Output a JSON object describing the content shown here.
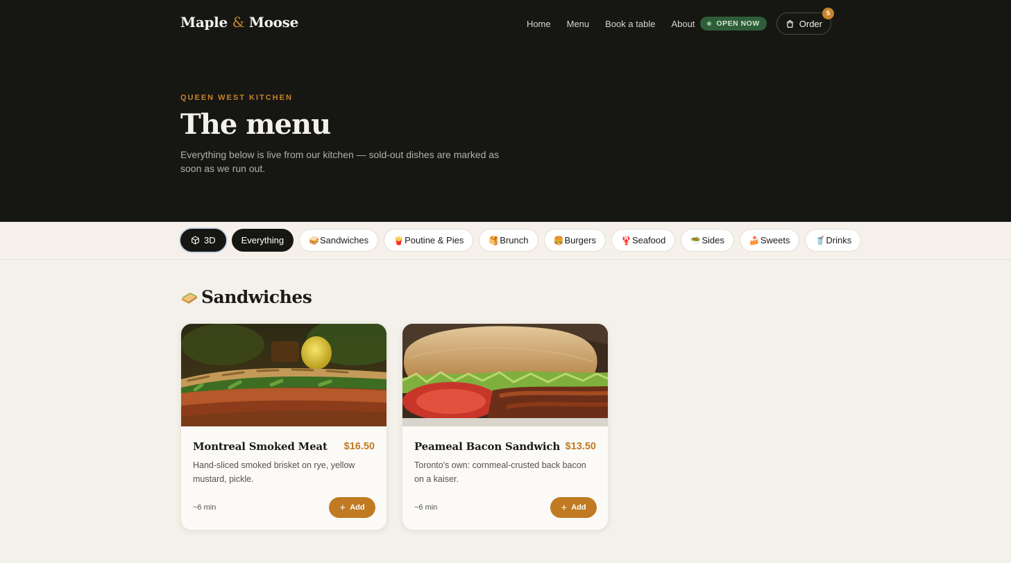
{
  "brand": {
    "name_part1": "Maple",
    "ampersand": "&",
    "name_part2": "Moose",
    "accent_color": "#c9832a"
  },
  "nav": {
    "links": [
      "Home",
      "Menu",
      "Book a table",
      "About"
    ],
    "status_badge": "OPEN NOW",
    "order_label": "Order",
    "order_count": "5"
  },
  "hero": {
    "eyebrow": "QUEEN WEST KITCHEN",
    "title": "The menu",
    "subtitle": "Everything below is live from our kitchen — sold-out dishes are marked as soon as we run out."
  },
  "filters": {
    "toggle_3d": "3D",
    "chips": [
      {
        "emoji": "",
        "label": "Everything",
        "active": true
      },
      {
        "emoji": "🥪",
        "label": "Sandwiches"
      },
      {
        "emoji": "🍟",
        "label": "Poutine & Pies"
      },
      {
        "emoji": "🥞",
        "label": "Brunch"
      },
      {
        "emoji": "🍔",
        "label": "Burgers"
      },
      {
        "emoji": "🦞",
        "label": "Seafood"
      },
      {
        "emoji": "🥗",
        "label": "Sides"
      },
      {
        "emoji": "🍰",
        "label": "Sweets"
      },
      {
        "emoji": "🥤",
        "label": "Drinks"
      }
    ]
  },
  "section": {
    "emoji": "🥪",
    "title": "Sandwiches"
  },
  "items": [
    {
      "name": "Montreal Smoked Meat",
      "price": "$16.50",
      "description": "Hand-sliced smoked brisket on rye, yellow mustard, pickle.",
      "time": "~6 min",
      "add_label": "Add"
    },
    {
      "name": "Peameal Bacon Sandwich",
      "price": "$13.50",
      "description": "Toronto's own: cornmeal-crusted back bacon on a kaiser.",
      "time": "~6 min",
      "add_label": "Add"
    }
  ]
}
